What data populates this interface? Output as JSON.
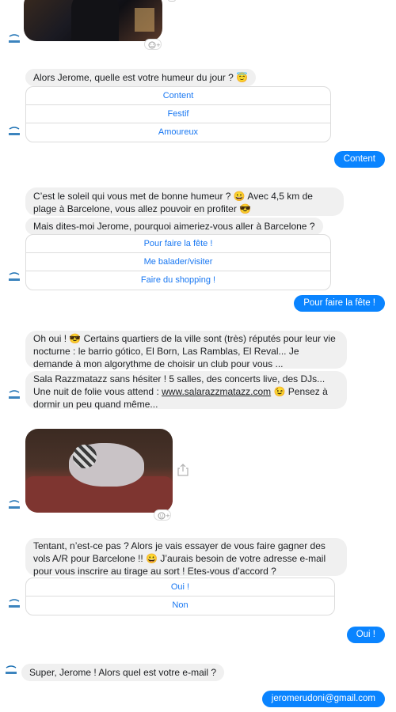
{
  "avatar_icon": "bot-logo-icon",
  "messages": {
    "m1": "Alors Jerome, quelle est votre humeur du jour ?",
    "m1_emoji": "😇",
    "qr1": [
      "Content",
      "Festif",
      "Amoureux"
    ],
    "u1": "Content",
    "m2": "C’est le soleil qui vous met de bonne humeur ? 😀 Avec 4,5 km de plage à Barcelone, vous allez pouvoir en profiter 😎",
    "m3": "Mais dites-moi Jerome, pourquoi aimeriez-vous aller à Barcelone ?",
    "qr2": [
      "Pour faire la fête !",
      "Me balader/visiter",
      "Faire du shopping !"
    ],
    "u2": "Pour faire la fête !",
    "m4": "Oh oui ! 😎 Certains quartiers de la ville sont (très) réputés pour leur vie nocturne : le barrio gótico, El Born, Las Ramblas, El Reval... Je demande à mon algorythme de choisir un club pour vous ...",
    "m5_before": "Sala Razzmatazz sans hésiter ! 5 salles, des concerts live, des DJs... Une nuit de folie vous attend : ",
    "m5_link": "www.salarazzmatazz.com",
    "m5_after": " 😉 Pensez à dormir un peu quand même...",
    "m6": "Tentant, n’est-ce pas ? Alors je vais essayer de vous faire gagner des vols A/R pour Barcelone !! 😀 J’aurais besoin de votre adresse e-mail pour vous inscrire au tirage au sort ! Etes-vous d’accord ?",
    "qr3": [
      "Oui  !",
      "Non"
    ],
    "u3": "Oui  !",
    "m7": "Super, Jerome ! Alors quel est votre e-mail ?",
    "u4": "jeromerudoni@gmail.com"
  },
  "icons": {
    "reaction": "add-reaction-icon",
    "share": "share-icon"
  },
  "colors": {
    "outgoing": "#0a84ff",
    "incoming": "#f0f0f0",
    "quick_reply_text": "#1877f2"
  }
}
